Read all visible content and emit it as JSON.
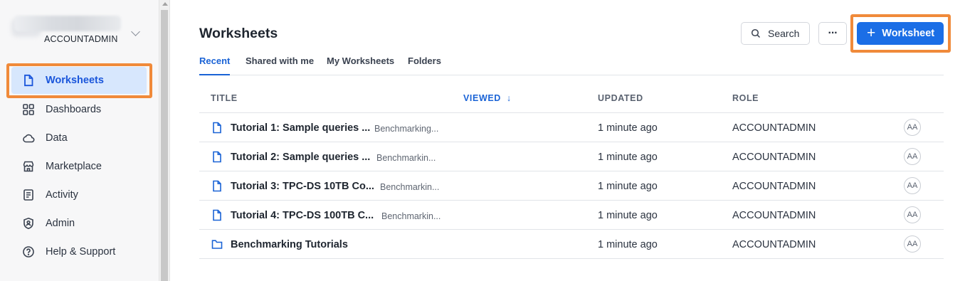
{
  "account": {
    "role": "ACCOUNTADMIN"
  },
  "sidebar": {
    "items": [
      {
        "label": "Worksheets",
        "icon": "worksheet-icon",
        "active": true
      },
      {
        "label": "Dashboards",
        "icon": "dashboard-grid-icon"
      },
      {
        "label": "Data",
        "icon": "cloud-icon"
      },
      {
        "label": "Marketplace",
        "icon": "storefront-icon"
      },
      {
        "label": "Activity",
        "icon": "activity-log-icon"
      },
      {
        "label": "Admin",
        "icon": "shield-user-icon"
      },
      {
        "label": "Help & Support",
        "icon": "help-circle-icon"
      }
    ]
  },
  "header": {
    "title": "Worksheets",
    "search_label": "Search",
    "more_label": "···",
    "new_worksheet_label": "Worksheet",
    "new_worksheet_plus": "+"
  },
  "tabs": [
    {
      "label": "Recent",
      "active": true
    },
    {
      "label": "Shared with me"
    },
    {
      "label": "My Worksheets"
    },
    {
      "label": "Folders"
    }
  ],
  "table": {
    "columns": {
      "title": "TITLE",
      "viewed": "VIEWED",
      "viewed_sort_arrow": "↓",
      "updated": "UPDATED",
      "role": "ROLE"
    },
    "rows": [
      {
        "type": "worksheet",
        "title": "Tutorial 1: Sample queries ...",
        "folder": "Benchmarking...",
        "updated": "1 minute ago",
        "role": "ACCOUNTADMIN",
        "owner": "AA"
      },
      {
        "type": "worksheet",
        "title": "Tutorial 2: Sample queries ...",
        "folder": "Benchmarkin...",
        "updated": "1 minute ago",
        "role": "ACCOUNTADMIN",
        "owner": "AA"
      },
      {
        "type": "worksheet",
        "title": "Tutorial 3: TPC-DS 10TB Co...",
        "folder": "Benchmarkin...",
        "updated": "1 minute ago",
        "role": "ACCOUNTADMIN",
        "owner": "AA"
      },
      {
        "type": "worksheet",
        "title": "Tutorial 4: TPC-DS 100TB C...",
        "folder": "Benchmarkin...",
        "updated": "1 minute ago",
        "role": "ACCOUNTADMIN",
        "owner": "AA"
      },
      {
        "type": "folder",
        "title": "Benchmarking Tutorials",
        "folder": "",
        "updated": "1 minute ago",
        "role": "ACCOUNTADMIN",
        "owner": "AA"
      }
    ]
  },
  "colors": {
    "accent": "#1b6ee6",
    "highlight": "#f08a3a",
    "active_nav_bg": "#d7e7fd"
  }
}
